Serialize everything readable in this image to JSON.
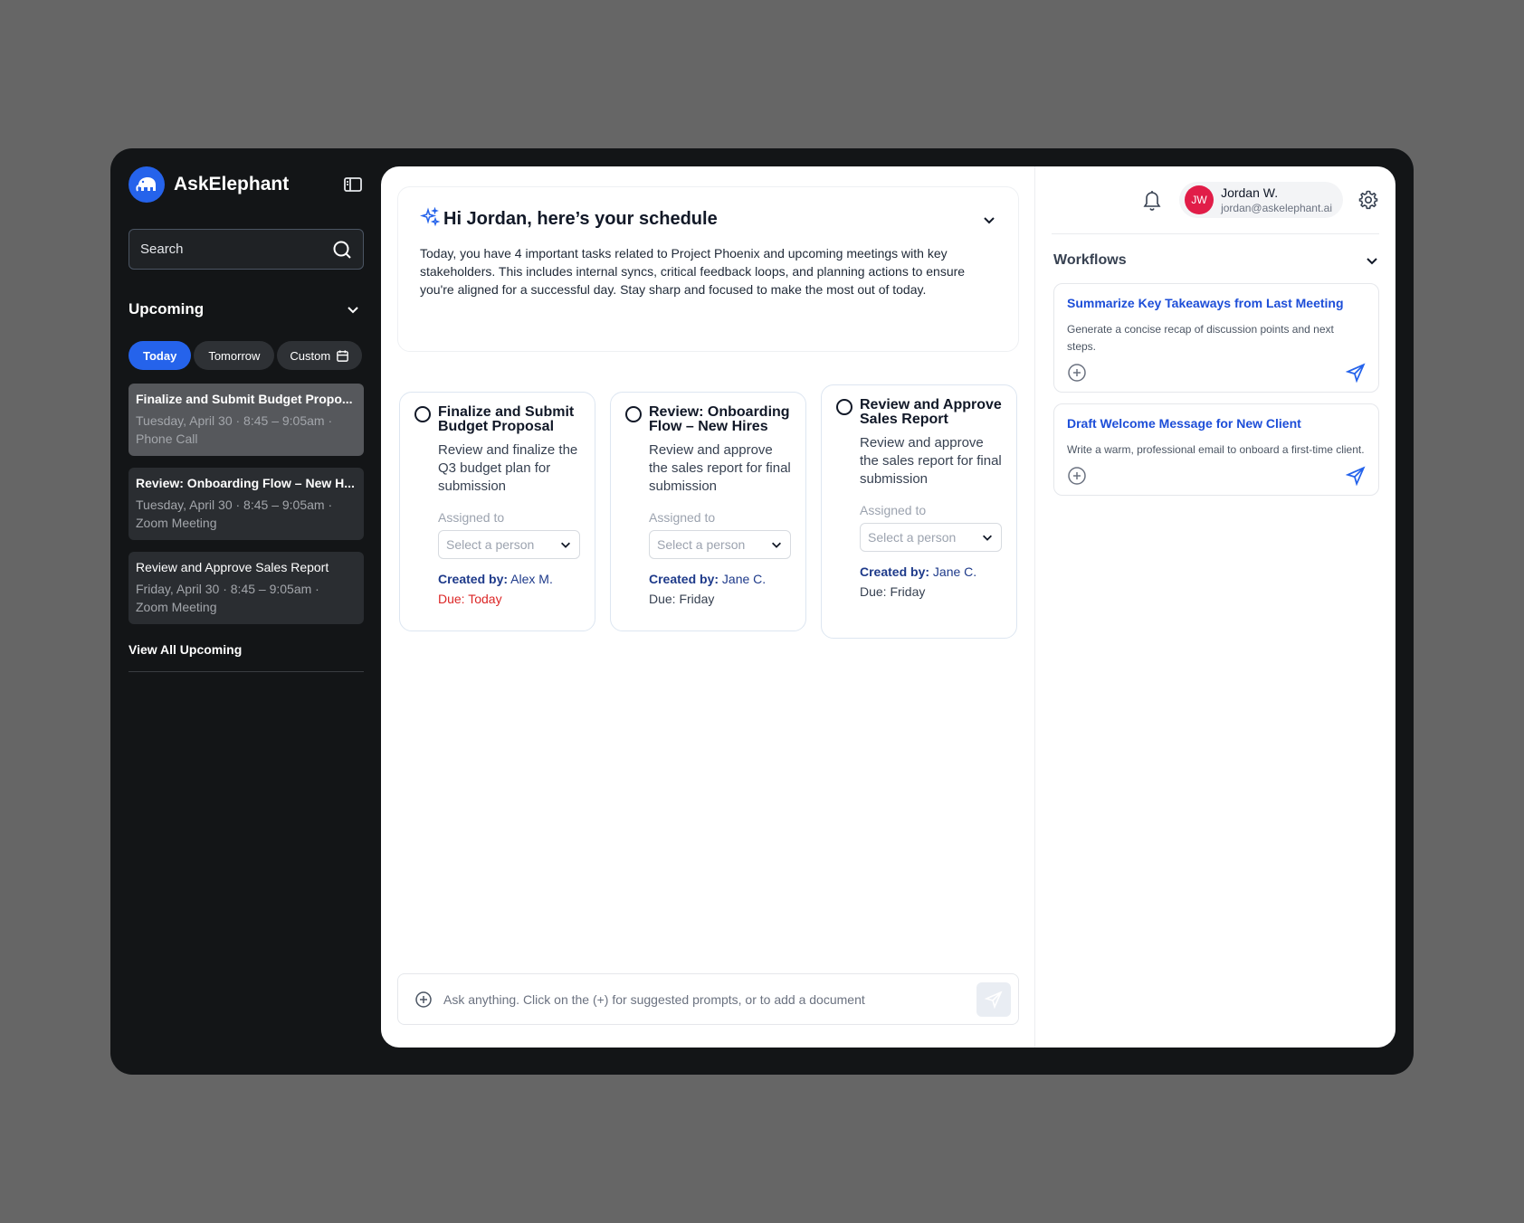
{
  "app": {
    "name": "AskElephant"
  },
  "sidebar": {
    "search_placeholder": "Search",
    "upcoming_title": "Upcoming",
    "filters": [
      {
        "label": "Today"
      },
      {
        "label": "Tomorrow"
      },
      {
        "label": "Custom"
      }
    ],
    "events": [
      {
        "title": "Finalize and Submit Budget Propo...",
        "when": "Tuesday, April 30 · 8:45 – 9:05am ·",
        "type": "Phone Call"
      },
      {
        "title": "Review: Onboarding Flow – New H...",
        "when": "Tuesday, April 30 · 8:45 – 9:05am ·",
        "type": "Zoom Meeting"
      },
      {
        "title": "Review and Approve Sales Report",
        "when": "Friday, April 30 · 8:45 – 9:05am ·",
        "type": "Zoom Meeting"
      }
    ],
    "view_all": "View All Upcoming"
  },
  "schedule": {
    "title": "Hi Jordan, here’s your schedule",
    "body": "Today, you have 4 important tasks related to Project Phoenix and upcoming meetings with key stakeholders. This includes internal syncs, critical feedback loops, and planning actions to ensure you're aligned for a successful day. Stay sharp and focused to make the most out of today."
  },
  "tasks": [
    {
      "title": "Finalize and Submit Budget Proposal",
      "desc": "Review and finalize the Q3 budget plan for submission",
      "assigned_label": "Assigned to",
      "select_placeholder": "Select a person",
      "created_label": "Created by:",
      "created_by": "Alex M.",
      "due_label": "Due:",
      "due": "Today"
    },
    {
      "title": "Review: Onboarding Flow – New Hires",
      "desc": "Review and approve the sales report for final submission",
      "assigned_label": "Assigned to",
      "select_placeholder": "Select a person",
      "created_label": "Created by:",
      "created_by": "Jane C.",
      "due_label": "Due:",
      "due": "Friday"
    },
    {
      "title": "Review and Approve Sales Report",
      "desc": "Review and approve the sales report for final submission",
      "assigned_label": "Assigned to",
      "select_placeholder": "Select a person",
      "created_label": "Created by:",
      "created_by": "Jane C.",
      "due_label": "Due:",
      "due": "Friday"
    }
  ],
  "chat": {
    "placeholder": "Ask anything. Click on the (+) for suggested prompts, or to add a document"
  },
  "user": {
    "initials": "JW",
    "name": "Jordan W.",
    "email": "jordan@askelephant.ai"
  },
  "workflows": {
    "title": "Workflows",
    "items": [
      {
        "name": "Summarize Key Takeaways from Last Meeting",
        "desc": "Generate a concise recap of discussion points and next steps."
      },
      {
        "name": "Draft Welcome Message for New Client",
        "desc": "Write a warm, professional email to onboard a first-time client."
      }
    ]
  },
  "colors": {
    "accent": "#2563eb",
    "due_urgent": "#dc2626",
    "avatar": "#e11d48",
    "sidebar_bg": "#131517"
  }
}
